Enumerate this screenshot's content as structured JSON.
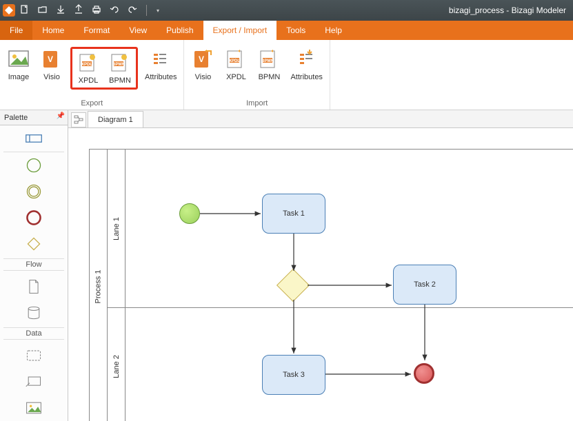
{
  "app": {
    "title": "bizagi_process - Bizagi Modeler"
  },
  "menu": {
    "file": "File",
    "home": "Home",
    "format": "Format",
    "view": "View",
    "publish": "Publish",
    "export_import": "Export / Import",
    "tools": "Tools",
    "help": "Help"
  },
  "ribbon": {
    "export": {
      "image": "Image",
      "visio": "Visio",
      "xpdl": "XPDL",
      "bpmn": "BPMN",
      "attributes": "Attributes",
      "group": "Export"
    },
    "import": {
      "visio": "Visio",
      "xpdl": "XPDL",
      "bpmn": "BPMN",
      "attributes": "Attributes",
      "group": "Import"
    }
  },
  "palette": {
    "title": "Palette",
    "flow": "Flow",
    "data": "Data"
  },
  "tabs": {
    "diagram1": "Diagram 1"
  },
  "diagram": {
    "pool": "Process 1",
    "lane1": "Lane 1",
    "lane2": "Lane 2",
    "task1": "Task 1",
    "task2": "Task 2",
    "task3": "Task 3"
  }
}
